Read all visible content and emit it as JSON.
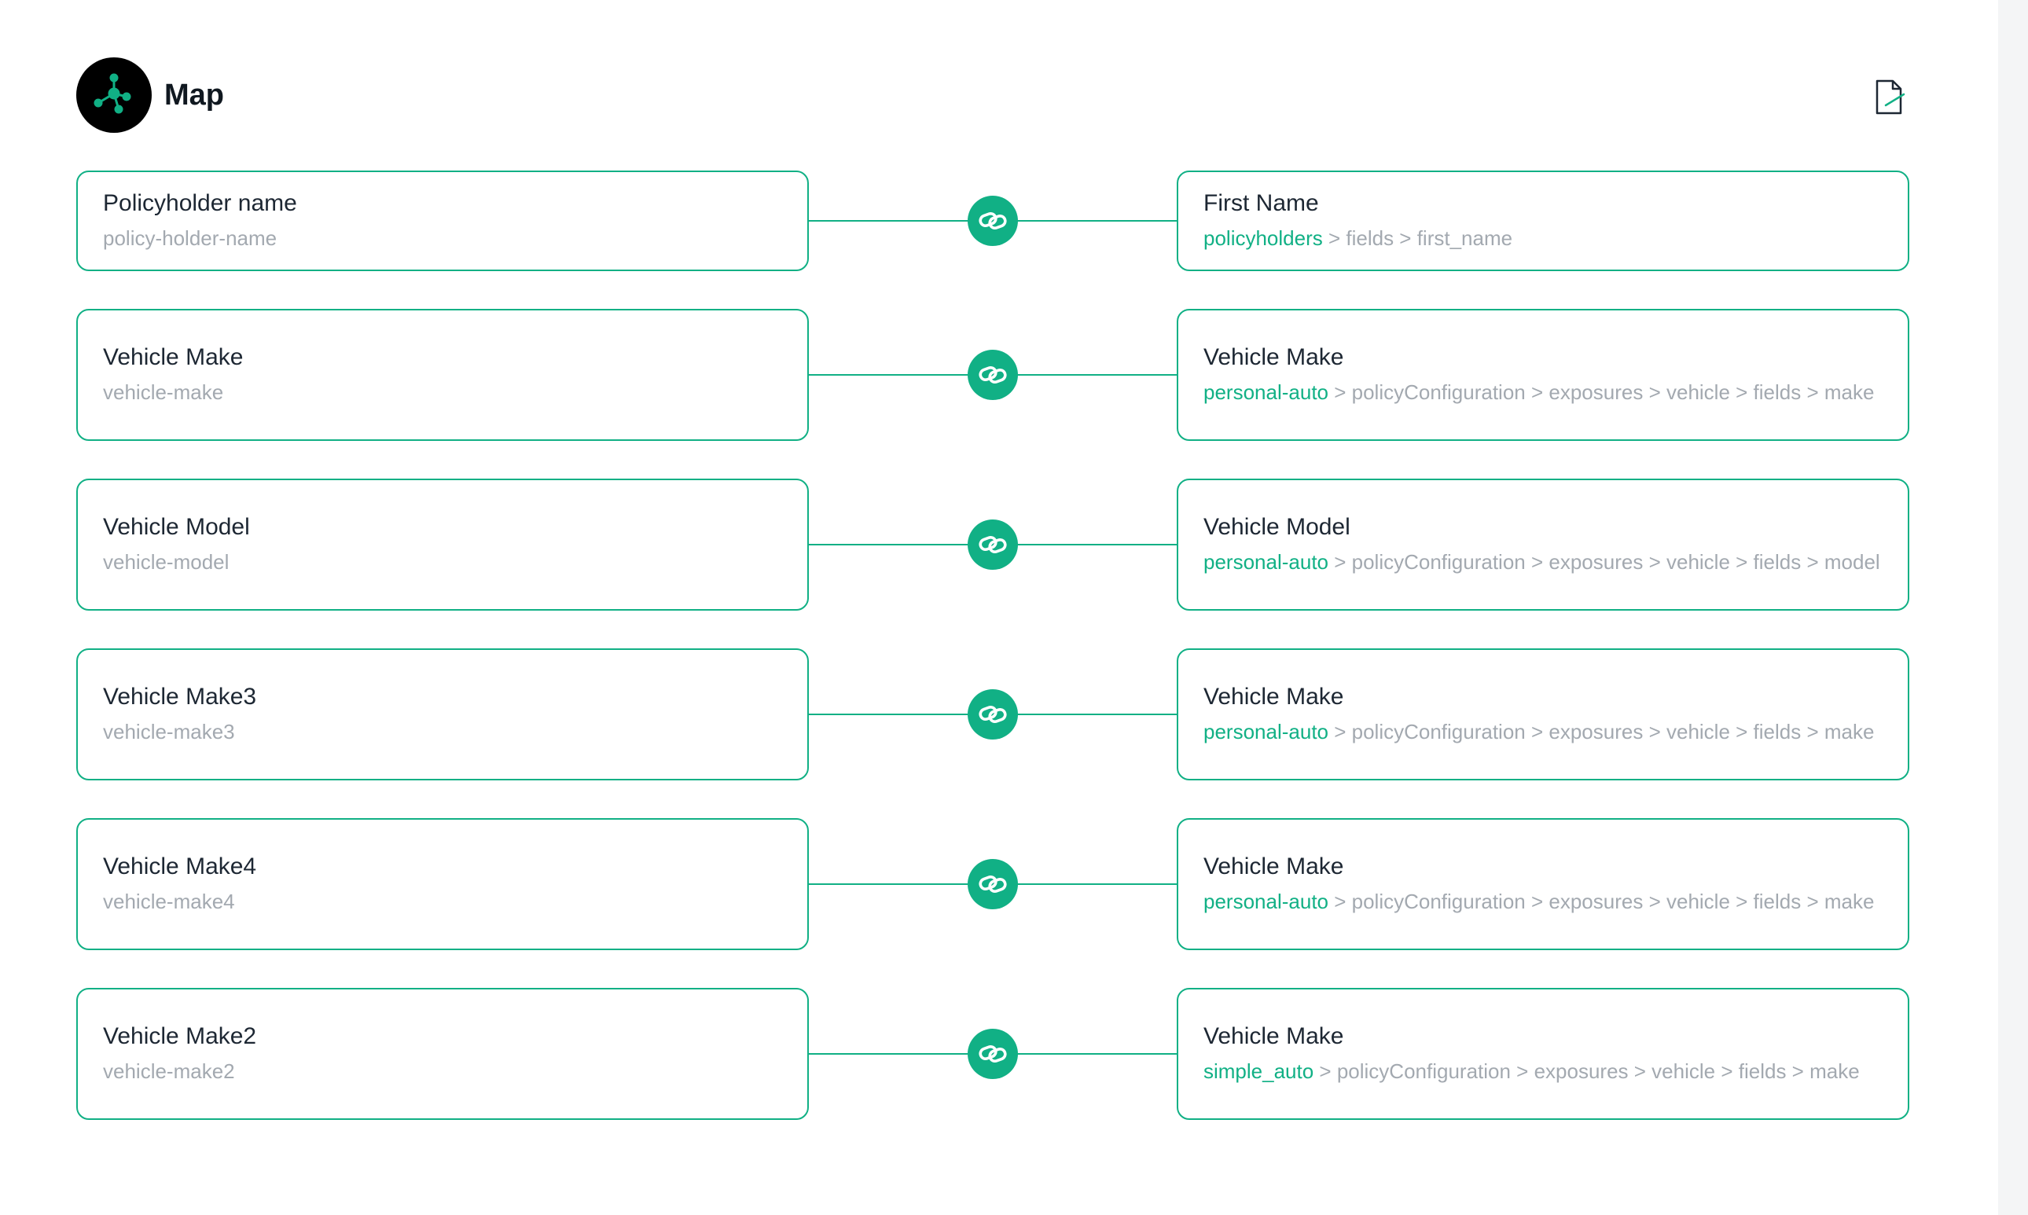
{
  "header": {
    "title": "Map",
    "logo_icon": "network-node-icon",
    "export_icon": "document-edit-icon"
  },
  "colors": {
    "accent": "#11b085",
    "text_primary": "#1d2733",
    "text_muted": "#a3a9b0",
    "logo_bg": "#000000"
  },
  "mappings": [
    {
      "source": {
        "label": "Policyholder name",
        "key": "policy-holder-name"
      },
      "target": {
        "label": "First Name",
        "path_root": "policyholders",
        "path_rest": " > fields > first_name"
      }
    },
    {
      "source": {
        "label": "Vehicle Make",
        "key": "vehicle-make"
      },
      "target": {
        "label": "Vehicle Make",
        "path_root": "personal-auto",
        "path_rest": " > policyConfiguration > exposures > vehicle > fields > make"
      }
    },
    {
      "source": {
        "label": "Vehicle Model",
        "key": "vehicle-model"
      },
      "target": {
        "label": "Vehicle Model",
        "path_root": "personal-auto",
        "path_rest": " > policyConfiguration > exposures > vehicle > fields > model"
      }
    },
    {
      "source": {
        "label": "Vehicle Make3",
        "key": "vehicle-make3"
      },
      "target": {
        "label": "Vehicle Make",
        "path_root": "personal-auto",
        "path_rest": " > policyConfiguration > exposures > vehicle > fields > make"
      }
    },
    {
      "source": {
        "label": "Vehicle Make4",
        "key": "vehicle-make4"
      },
      "target": {
        "label": "Vehicle Make",
        "path_root": "personal-auto",
        "path_rest": " > policyConfiguration > exposures > vehicle > fields > make"
      }
    },
    {
      "source": {
        "label": "Vehicle Make2",
        "key": "vehicle-make2"
      },
      "target": {
        "label": "Vehicle Make",
        "path_root": "simple_auto",
        "path_rest": " > policyConfiguration > exposures > vehicle > fields > make"
      }
    }
  ],
  "link_icon": "link-icon"
}
